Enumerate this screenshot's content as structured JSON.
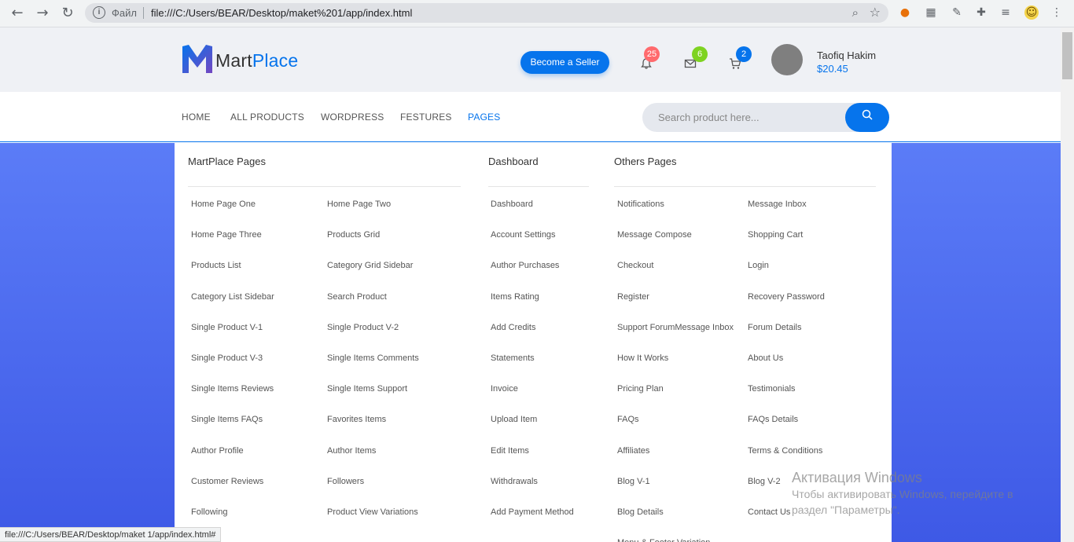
{
  "browser": {
    "back_icon": "back-arrow-icon",
    "forward_icon": "forward-arrow-icon",
    "reload_icon": "reload-icon",
    "scheme_label": "Файл",
    "url": "file:///C:/Users/BEAR/Desktop/maket%201/app/index.html",
    "extensions": [
      "search-extension-icon",
      "qr-extension-icon",
      "pipette-extension-icon",
      "puzzle-extension-icon",
      "playlist-extension-icon",
      "avatar-extension-icon",
      "more-menu-icon"
    ]
  },
  "header": {
    "logo_main": "Mart",
    "logo_accent": "Place",
    "seller_button": "Become a Seller",
    "notifications_count": "25",
    "messages_count": "6",
    "cart_count": "2",
    "user_name": "Taofiq Hakim",
    "user_balance": "$20.45",
    "colors": {
      "primary": "#0674ec",
      "badge_red": "#ff6a6d",
      "badge_green": "#7ed321",
      "badge_blue": "#0674ec"
    }
  },
  "nav": {
    "items": [
      "HOME",
      "ALL PRODUCTS",
      "WORDPRESS",
      "FESTURES",
      "PAGES"
    ],
    "active": "PAGES",
    "search_placeholder": "Search product here..."
  },
  "mega_menu": {
    "martplace": {
      "title": "MartPlace Pages",
      "left": [
        "Home Page One",
        "Home Page Three",
        "Products List",
        "Category List Sidebar",
        "Single Product V-1",
        "Single Product V-3",
        "Single Items Reviews",
        "Single Items FAQs",
        "Author Profile",
        "Customer Reviews",
        "Following"
      ],
      "right": [
        "Home Page Two",
        "Products Grid",
        "Category Grid Sidebar",
        "Search Product",
        "Single Product V-2",
        "Single Items Comments",
        "Single Items Support",
        "Favorites Items",
        "Author Items",
        "Followers",
        "Product View Variations"
      ]
    },
    "dashboard": {
      "title": "Dashboard",
      "links": [
        "Dashboard",
        "Account Settings",
        "Author Purchases",
        "Items Rating",
        "Add Credits",
        "Statements",
        "Invoice",
        "Upload Item",
        "Edit Items",
        "Withdrawals",
        "Add Payment Method"
      ]
    },
    "others": {
      "title": "Others Pages",
      "left": [
        "Notifications",
        "Message Compose",
        "Checkout",
        "Register",
        "Support ForumMessage Inbox",
        "How It Works",
        "Pricing Plan",
        "FAQs",
        "Affiliates",
        "Blog V-1",
        "Blog Details",
        "Menu & Footer Variation"
      ],
      "right": [
        "Message Inbox",
        "Shopping Cart",
        "Login",
        "Recovery Password",
        "Forum Details",
        "About Us",
        "Testimonials",
        "FAQs Details",
        "Terms & Conditions",
        "Blog V-2",
        "Contact Us"
      ]
    }
  },
  "watermark": {
    "line1": "Активация Windows",
    "line2": "Чтобы активировать Windows, перейдите в",
    "line3": "раздел \"Параметры\"."
  },
  "status_bar": "file:///C:/Users/BEAR/Desktop/maket 1/app/index.html#"
}
